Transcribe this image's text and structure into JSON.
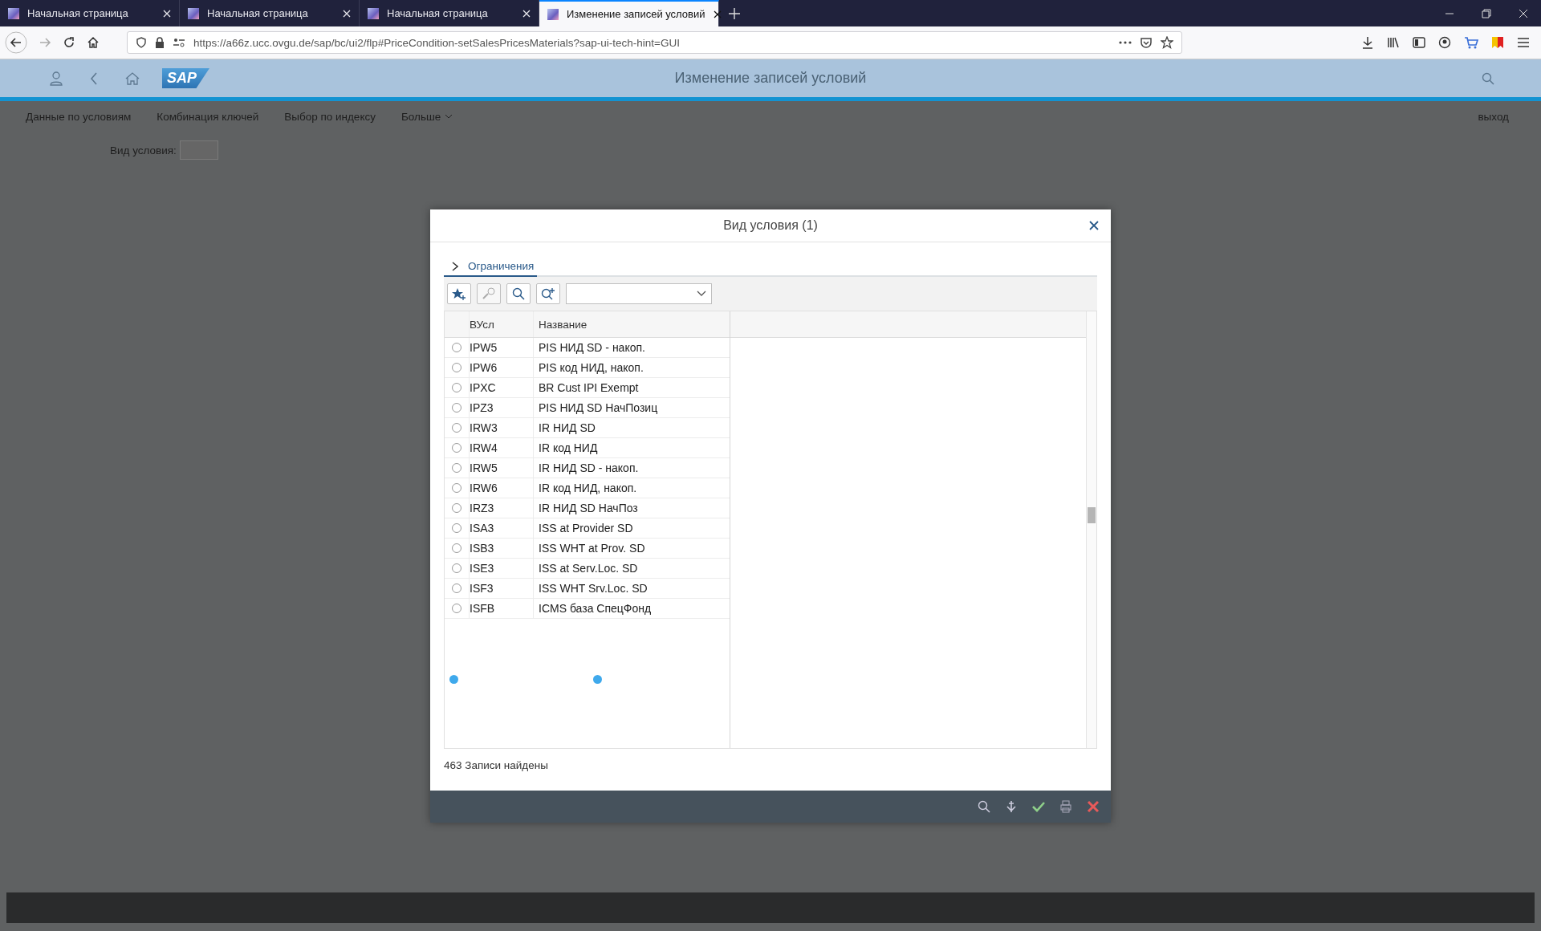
{
  "browser": {
    "tabs": [
      {
        "title": "Начальная страница",
        "selected": false
      },
      {
        "title": "Начальная страница",
        "selected": false
      },
      {
        "title": "Начальная страница",
        "selected": false
      },
      {
        "title": "Изменение записей условий",
        "selected": true
      }
    ],
    "url": "https://a66z.ucc.ovgu.de/sap/bc/ui2/flp#PriceCondition-setSalesPricesMaterials?sap-ui-tech-hint=GUI"
  },
  "shell": {
    "logo": "SAP",
    "title": "Изменение записей условий"
  },
  "menu": {
    "items": [
      "Данные по условиям",
      "Комбинация ключей",
      "Выбор по индексу",
      "Больше"
    ],
    "exit": "выход"
  },
  "field": {
    "label": "Вид условия:"
  },
  "dialog": {
    "title": "Вид условия (1)",
    "section": {
      "label": "Ограничения",
      "expanded": false
    },
    "columns": [
      "ВУсл",
      "Название"
    ],
    "rows": [
      {
        "code": "IPW5",
        "name": "PIS НИД SD - накоп.",
        "selected": false
      },
      {
        "code": "IPW6",
        "name": "PIS код НИД, накоп.",
        "selected": false
      },
      {
        "code": "IPXC",
        "name": "BR Cust  IPI Exempt",
        "selected": false
      },
      {
        "code": "IPZ3",
        "name": "PIS НИД SD НачПозиц",
        "selected": false
      },
      {
        "code": "IRW3",
        "name": "IR НИД SD",
        "selected": false
      },
      {
        "code": "IRW4",
        "name": "IR код НИД",
        "selected": false
      },
      {
        "code": "IRW5",
        "name": "IR НИД SD - накоп.",
        "selected": false
      },
      {
        "code": "IRW6",
        "name": "IR код НИД, накоп.",
        "selected": false
      },
      {
        "code": "IRZ3",
        "name": "IR НИД SD НачПоз",
        "selected": false
      },
      {
        "code": "ISA3",
        "name": "ISS at Provider SD",
        "selected": false
      },
      {
        "code": "ISB3",
        "name": "ISS WHT at Prov. SD",
        "selected": false
      },
      {
        "code": "ISE3",
        "name": "ISS at Serv.Loc. SD",
        "selected": false
      },
      {
        "code": "ISF3",
        "name": "ISS WHT  Srv.Loc. SD",
        "selected": false
      },
      {
        "code": "ISFB",
        "name": "ICMS база СпецФонд",
        "selected": false
      }
    ],
    "status": "463 Записи найдены"
  }
}
